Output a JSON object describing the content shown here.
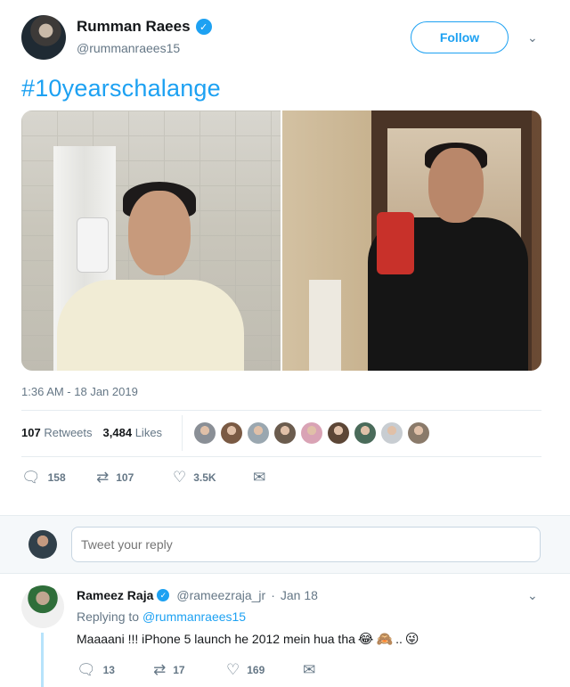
{
  "tweet": {
    "author": {
      "name": "Rumman Raees",
      "handle": "@rummanraees15",
      "verified_icon": "verified-badge-icon"
    },
    "follow_label": "Follow",
    "text": "#10yearschalange",
    "timestamp": "1:36 AM - 18 Jan 2019",
    "retweets_count": "107",
    "retweets_label": "Retweets",
    "likes_count": "3,484",
    "likes_label": "Likes",
    "likers": [
      "#8a8f96",
      "#7a5a44",
      "#9aa7b0",
      "#6b5c4e",
      "#d9a3b5",
      "#5c4636",
      "#4a6b5a",
      "#c8cdd2",
      "#8a7a6a"
    ],
    "actions": {
      "reply": "158",
      "retweet": "107",
      "like": "3.5K"
    }
  },
  "reply_box": {
    "placeholder": "Tweet your reply"
  },
  "reply": {
    "name": "Rameez Raja",
    "handle": "@rameezraja_jr",
    "date": "Jan 18",
    "replying_prefix": "Replying to",
    "replying_to": "@rummanraees15",
    "text": "Maaaani !!! iPhone 5 launch he 2012 mein hua tha",
    "emojis": [
      "😂",
      "🙈",
      "..",
      "😜"
    ],
    "actions": {
      "reply": "13",
      "retweet": "17",
      "like": "169"
    }
  },
  "colors": {
    "accent": "#1da1f2",
    "muted": "#657786",
    "text": "#14171a",
    "thread": "#b7e3fb"
  }
}
